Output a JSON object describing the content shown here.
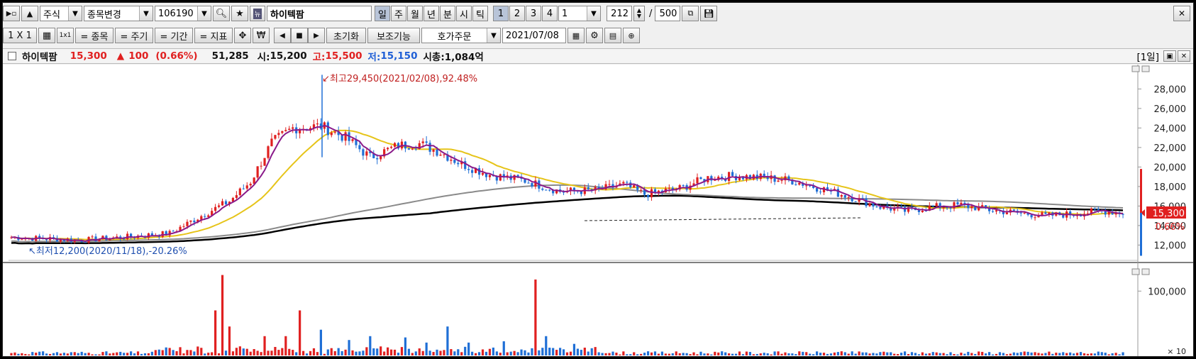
{
  "toolbar1": {
    "market": "주식",
    "change_label": "종목변경",
    "code": "106190",
    "stock_name": "하이텍팜",
    "periods": [
      "일",
      "주",
      "월",
      "년",
      "분",
      "시",
      "틱"
    ],
    "numbers": [
      "1",
      "2",
      "3",
      "4"
    ],
    "unit_value": "1",
    "count": "212",
    "slash": "/",
    "total": "500"
  },
  "toolbar2": {
    "layout_label": "1 X 1",
    "single_label": "1x1",
    "stock_label": "= 종목",
    "cycle_label": "= 주기",
    "period_label": "= 기간",
    "indicator_label": "= 지표",
    "won_label": "₩",
    "reset_label": "초기화",
    "aux_label": "보조기능",
    "order_label": "호가주문",
    "date": "2021/07/08"
  },
  "info": {
    "name": "하이텍팜",
    "price": "15,300",
    "change_sign": "▲",
    "change": "100",
    "change_pct": "(0.66%)",
    "volume": "51,285",
    "open_label": "시:",
    "open": "15,200",
    "high_label": "고:",
    "high": "15,500",
    "low_label": "저:",
    "low": "15,150",
    "cap_label": "시총:",
    "cap": "1,084억",
    "period_badge": "[1일]"
  },
  "chart_data": {
    "type": "candlestick",
    "price_axis": {
      "ticks": [
        "12,000",
        "14,000",
        "16,000",
        "18,000",
        "20,000",
        "22,000",
        "24,000",
        "26,000",
        "28,000"
      ],
      "ylim": [
        10500,
        30500
      ]
    },
    "volume_axis": {
      "ticks": [
        "100,000"
      ],
      "unit_label": "× 10",
      "ylim": [
        0,
        140000
      ]
    },
    "current_price_label": "15,300",
    "current_change_label": "0.66%",
    "annotation_high": "최고29,450(2021/02/08),92.48%",
    "annotation_low": "최저12,200(2020/11/18),-20.26%",
    "colors": {
      "up": "#e02020",
      "down": "#1f6fd6",
      "ma5": "#8a1a8a",
      "ma20": "#e6c419",
      "ma60": "#8a8a8a",
      "ma120": "#000000"
    }
  }
}
